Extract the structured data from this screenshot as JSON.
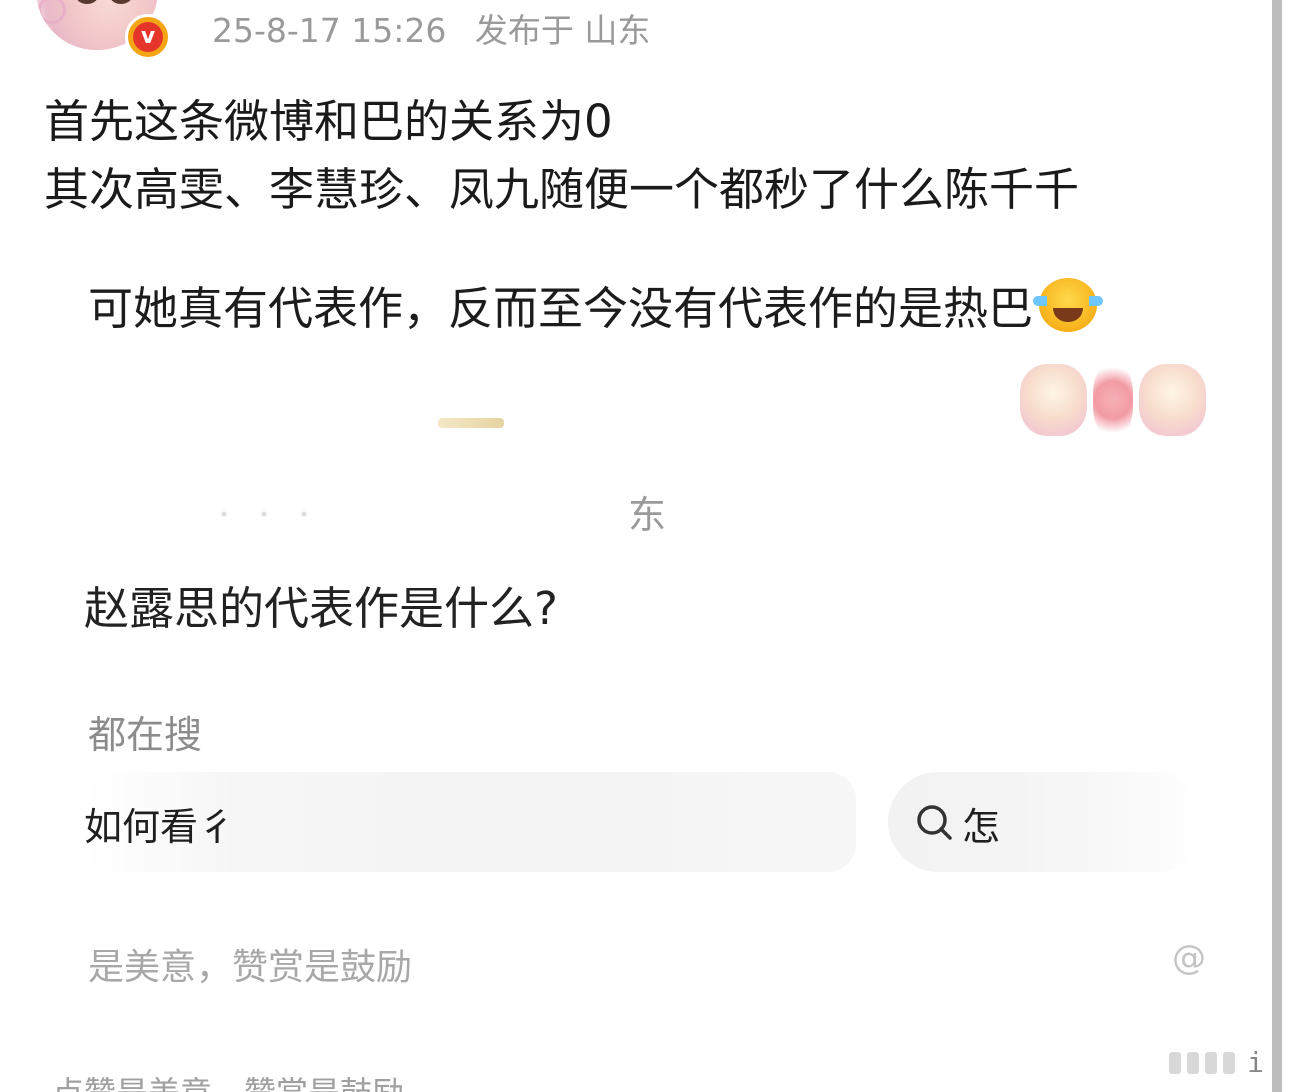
{
  "post": {
    "timestamp": "25-8-17 15:26",
    "location": "发布于 山东",
    "lines": [
      "首先这条微博和巴的关系为0",
      "其次高雯、李慧珍、凤九随便一个都秒了什么陈千千"
    ]
  },
  "screenshot": {
    "quote": "可她真有代表作，反而至今没有代表作的是热巴",
    "fragment": "东",
    "question": "赵露思的代表作是什么?",
    "section_label": "都在搜",
    "search_left": "如何看彳",
    "search_right": "怎",
    "footer": "是美意，赞赏是鼓励",
    "watermark": "@"
  },
  "outer_footer": "点赞是美意，赞赏是鼓励",
  "icons": {
    "avatar": "avatar-image",
    "verified": "verified-badge-icon",
    "emoji": "laugh-cry-emoji-icon",
    "search": "search-icon"
  },
  "colors": {
    "verified_orange": "#f4a516",
    "verified_red": "#e5352b",
    "meta_gray": "#9a9a9a"
  }
}
